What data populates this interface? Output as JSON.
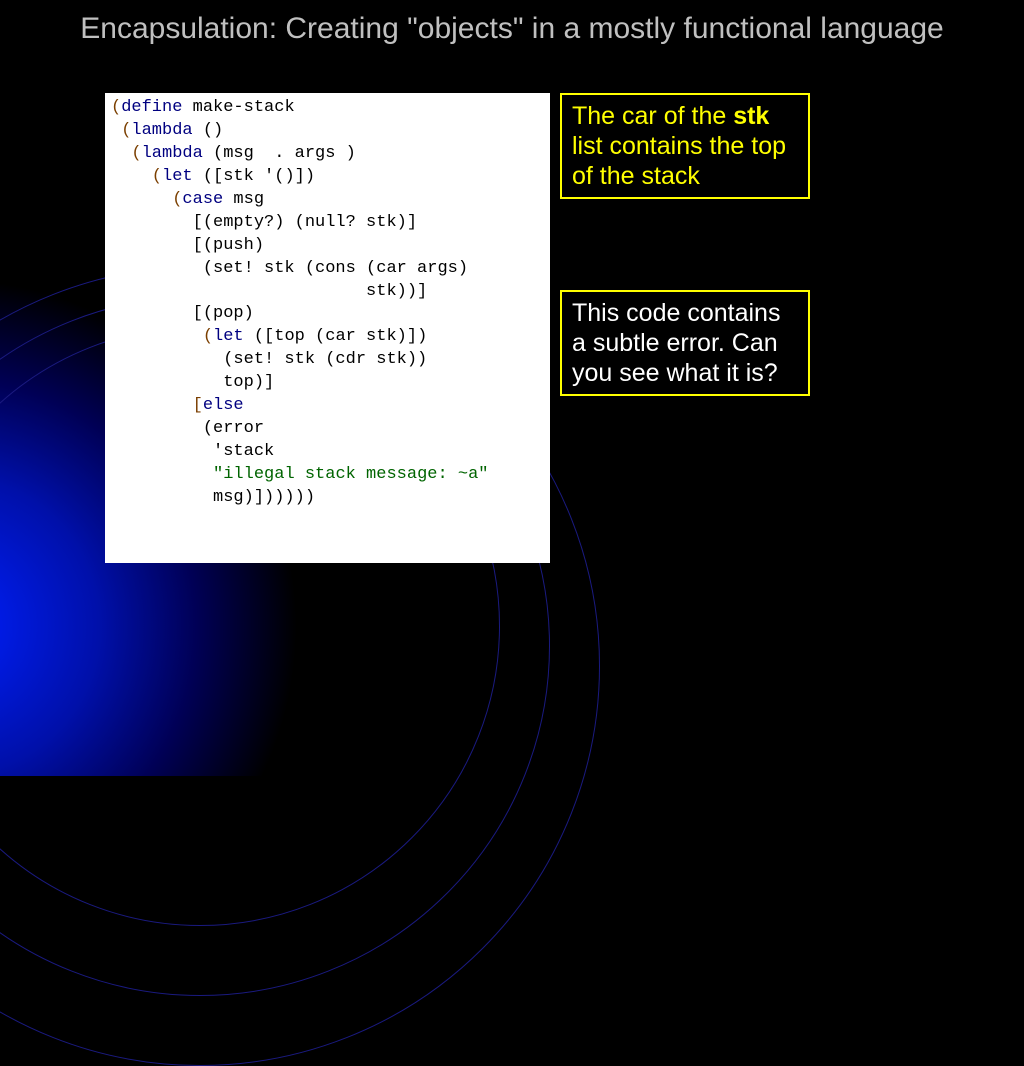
{
  "title": "Encapsulation: Creating \"objects\" in a mostly functional language",
  "code": {
    "l1a": "(",
    "l1b": "define",
    "l1c": " make-stack",
    "l2a": " (",
    "l2b": "lambda",
    "l2c": " ()",
    "l3a": "  (",
    "l3b": "lambda",
    "l3c": " (msg  . args )",
    "l4a": "    (",
    "l4b": "let",
    "l4c": " ([stk '()])",
    "l5a": "      (",
    "l5b": "case",
    "l5c": " msg",
    "l6": "        [(empty?) (null? stk)]",
    "l7": "        [(push)",
    "l8": "         (set! stk (cons (car args)",
    "l9": "                         stk))]",
    "l10": "        [(pop)",
    "l11a": "         (",
    "l11b": "let",
    "l11c": " ([top (car stk)])",
    "l12": "           (set! stk (cdr stk))",
    "l13": "           top)]",
    "l14a": "        [",
    "l14b": "else",
    "l15": "         (error",
    "l16": "          'stack",
    "l17a": "          ",
    "l17b": "\"illegal stack message: ~a\"",
    "l18": "          msg)])))))"
  },
  "note1": {
    "pre": "The car of the ",
    "bold": "stk",
    "post": " list contains the top of the stack"
  },
  "note2": "This code contains a subtle error. Can you see what it is?"
}
